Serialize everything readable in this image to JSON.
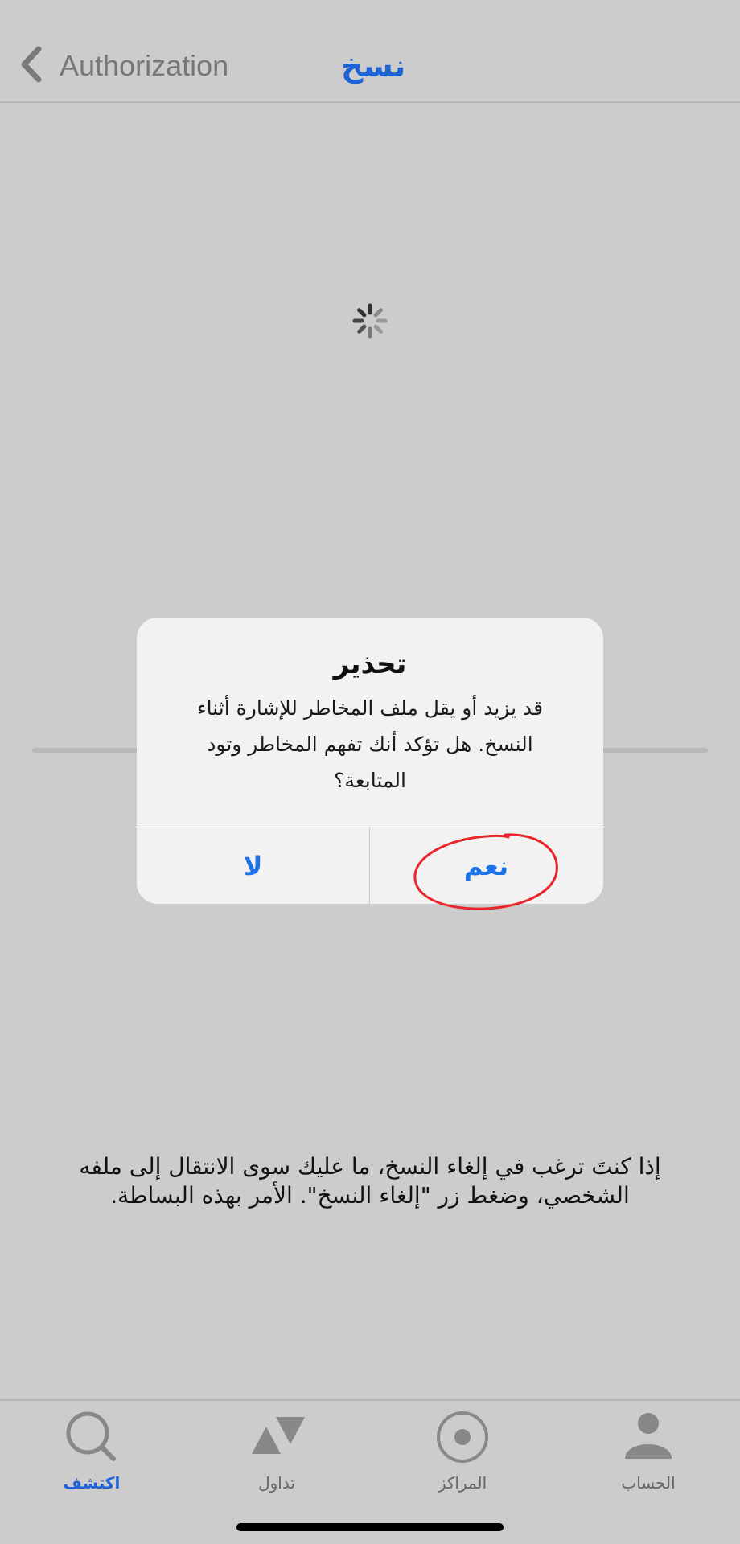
{
  "navbar": {
    "back_label": "Authorization",
    "title": "نسخ"
  },
  "dialog": {
    "title": "تحذير",
    "message_line1": "قد يزيد أو يقل ملف المخاطر للإشارة أثناء",
    "message_line2": "النسخ. هل تؤكد أنك تفهم المخاطر وتود",
    "message_line3": "المتابعة؟",
    "no_label": "لا",
    "yes_label": "نعم"
  },
  "info": {
    "line1": "إذا كنتَ ترغب في إلغاء النسخ، ما عليك سوى الانتقال إلى ملفه",
    "line2": "الشخصي، وضغط زر \"إلغاء النسخ\". الأمر بهذه البساطة."
  },
  "tabs": [
    {
      "label": "اكتشف",
      "icon": "search-icon",
      "active": true
    },
    {
      "label": "تداول",
      "icon": "trade-icon",
      "active": false
    },
    {
      "label": "المراكز",
      "icon": "positions-icon",
      "active": false
    },
    {
      "label": "الحساب",
      "icon": "person-icon",
      "active": false
    }
  ],
  "colors": {
    "accent": "#1d63d6",
    "dialog_button": "#1a73e8",
    "annotation_circle": "#e8262b",
    "background": "#cccccc"
  }
}
